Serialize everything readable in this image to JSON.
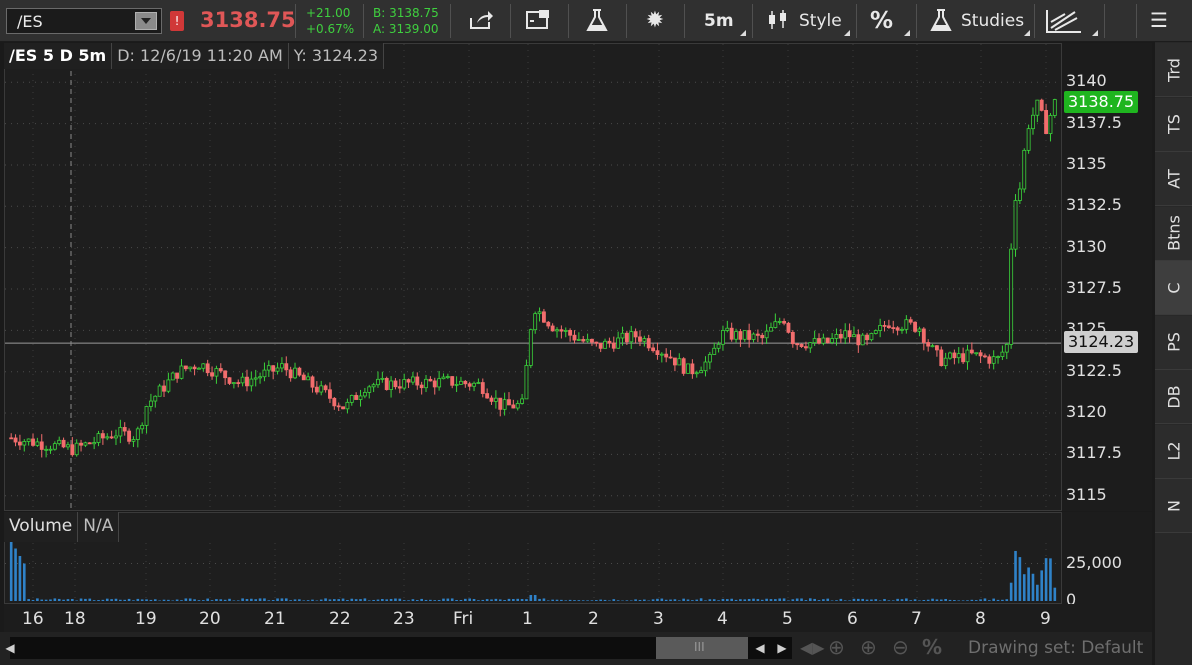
{
  "toolbar": {
    "symbol": "/ES",
    "alert": "!",
    "last_price": "3138.75",
    "change_abs": "+21.00",
    "change_pct": "+0.67%",
    "bid": "B: 3138.75",
    "ask": "A: 3139.00",
    "interval_label": "5m",
    "style_label": "Style",
    "percent_label": "%",
    "studies_label": "Studies",
    "menu_icon": "☰"
  },
  "chart_header": {
    "symbol": "/ES 5 D 5m",
    "date": "D: 12/6/19 11:20 AM",
    "y_value": "Y: 3124.23"
  },
  "volume_header": {
    "label": "Volume",
    "value": "N/A"
  },
  "colors": {
    "up": "#3ad13a",
    "down": "#f26d6d",
    "volume": "#2f82c8",
    "last_price_tag": "#1fb51f",
    "crosshair_tag": "#cfcfcf"
  },
  "price_axis": {
    "ticks": [
      "3140",
      "3137.5",
      "3135",
      "3132.5",
      "3130",
      "3127.5",
      "3125",
      "3122.5",
      "3120",
      "3117.5",
      "3115"
    ],
    "last_price_tag": "3138.75",
    "crosshair_tag": "3124.23"
  },
  "volume_axis": {
    "ticks": [
      "25,000",
      "0"
    ]
  },
  "time_axis": {
    "labels": [
      "16",
      "18",
      "19",
      "20",
      "21",
      "22",
      "23",
      "Fri",
      "1",
      "2",
      "3",
      "4",
      "5",
      "6",
      "7",
      "8",
      "9"
    ]
  },
  "bottom_bar": {
    "drawing_set": "Drawing set: Default"
  },
  "sidebar": {
    "tabs": [
      "Trd",
      "TS",
      "AT",
      "Btns",
      "C",
      "PS",
      "DB",
      "L2",
      "N"
    ],
    "active": "C"
  },
  "chart_data": {
    "type": "candlestick",
    "instrument": "/ES",
    "ylim": [
      3114.5,
      3140.5
    ],
    "volume_ylim": [
      0,
      40000
    ],
    "crosshair_y": 3124.23,
    "anchors": [
      {
        "t": 0,
        "p": 3118.5
      },
      {
        "t": 0.06,
        "p": 3117.8
      },
      {
        "t": 0.1,
        "p": 3118.8
      },
      {
        "t": 0.12,
        "p": 3118.6
      },
      {
        "t": 0.13,
        "p": 3120.5
      },
      {
        "t": 0.16,
        "p": 3122.5
      },
      {
        "t": 0.18,
        "p": 3123.0
      },
      {
        "t": 0.22,
        "p": 3121.8
      },
      {
        "t": 0.26,
        "p": 3122.8
      },
      {
        "t": 0.3,
        "p": 3121.2
      },
      {
        "t": 0.32,
        "p": 3120.3
      },
      {
        "t": 0.34,
        "p": 3121.7
      },
      {
        "t": 0.38,
        "p": 3121.8
      },
      {
        "t": 0.42,
        "p": 3121.9
      },
      {
        "t": 0.45,
        "p": 3121.7
      },
      {
        "t": 0.47,
        "p": 3120.4
      },
      {
        "t": 0.49,
        "p": 3120.5
      },
      {
        "t": 0.5,
        "p": 3126.5
      },
      {
        "t": 0.52,
        "p": 3125.2
      },
      {
        "t": 0.56,
        "p": 3124.0
      },
      {
        "t": 0.6,
        "p": 3124.7
      },
      {
        "t": 0.63,
        "p": 3123.5
      },
      {
        "t": 0.65,
        "p": 3122.5
      },
      {
        "t": 0.67,
        "p": 3123.2
      },
      {
        "t": 0.68,
        "p": 3124.8
      },
      {
        "t": 0.72,
        "p": 3124.5
      },
      {
        "t": 0.74,
        "p": 3125.8
      },
      {
        "t": 0.75,
        "p": 3124.3
      },
      {
        "t": 0.78,
        "p": 3124.2
      },
      {
        "t": 0.8,
        "p": 3124.8
      },
      {
        "t": 0.82,
        "p": 3124.2
      },
      {
        "t": 0.84,
        "p": 3125.5
      },
      {
        "t": 0.87,
        "p": 3125.2
      },
      {
        "t": 0.88,
        "p": 3124.0
      },
      {
        "t": 0.89,
        "p": 3123.2
      },
      {
        "t": 0.92,
        "p": 3123.5
      },
      {
        "t": 0.945,
        "p": 3123.2
      },
      {
        "t": 0.955,
        "p": 3124.2
      },
      {
        "t": 0.96,
        "p": 3133.5
      },
      {
        "t": 0.965,
        "p": 3132.8
      },
      {
        "t": 0.97,
        "p": 3135.5
      },
      {
        "t": 0.975,
        "p": 3137.5
      },
      {
        "t": 0.985,
        "p": 3138.8
      },
      {
        "t": 0.99,
        "p": 3137.0
      },
      {
        "t": 1.0,
        "p": 3138.75
      }
    ]
  }
}
